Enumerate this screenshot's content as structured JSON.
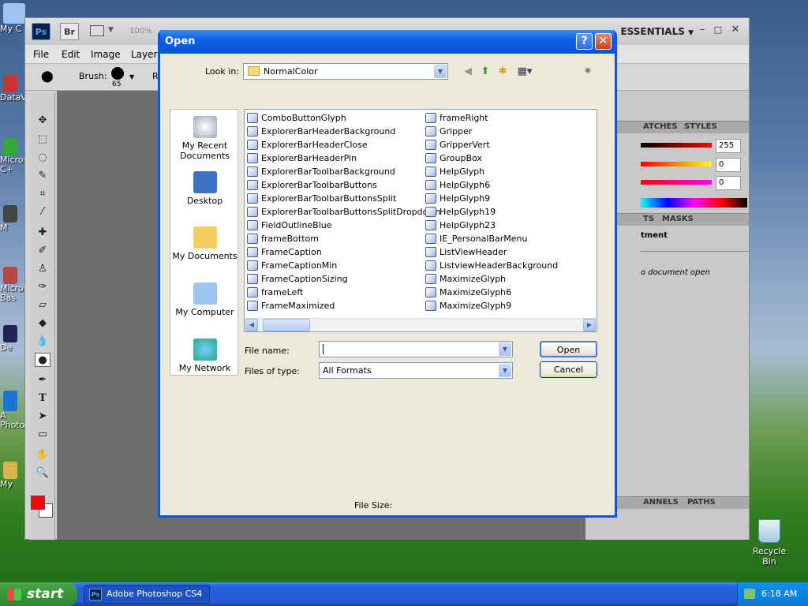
{
  "desktop": {
    "icons": [
      {
        "label": "My C",
        "name": "my-computer-desktop-icon"
      },
      {
        "label": "DataV",
        "name": "datav-desktop-icon"
      },
      {
        "label": "Micros C+",
        "name": "microsoft-cpp-desktop-icon"
      },
      {
        "label": "M",
        "name": "m-desktop-icon"
      },
      {
        "label": "Micros Bas",
        "name": "microsoft-basic-desktop-icon"
      },
      {
        "label": "De",
        "name": "de-desktop-icon"
      },
      {
        "label": "A Photo",
        "name": "adobe-photoshop-desktop-icon"
      },
      {
        "label": "My",
        "name": "my-desktop-icon"
      }
    ],
    "recycle_bin": "Recycle Bin"
  },
  "photoshop": {
    "logo": "Ps",
    "bridge": "Br",
    "zoom": "100%",
    "workspace": "ESSENTIALS",
    "menus": [
      "File",
      "Edit",
      "Image",
      "Layer"
    ],
    "options": {
      "brush_label": "Brush:",
      "brush_size": "65",
      "r_label": "R"
    },
    "panels": {
      "tabs1": [
        "ATCHES",
        "STYLES"
      ],
      "color_values": [
        "255",
        "0",
        "0"
      ],
      "tabs2": [
        "TS",
        "MASKS"
      ],
      "adjust_title": "tment",
      "no_doc": "o document open",
      "tabs3": [
        "ANNELS",
        "PATHS"
      ]
    },
    "colors": {
      "foreground": "#ff0000",
      "background": "#ffffff"
    }
  },
  "dialog": {
    "title": "Open",
    "look_in_label": "Look in:",
    "look_in_value": "NormalColor",
    "places": [
      "My Recent Documents",
      "Desktop",
      "My Documents",
      "My Computer",
      "My Network"
    ],
    "files_col1": [
      "ComboButtonGlyph",
      "ExplorerBarHeaderBackground",
      "ExplorerBarHeaderClose",
      "ExplorerBarHeaderPin",
      "ExplorerBarToolbarBackground",
      "ExplorerBarToolbarButtons",
      "ExplorerBarToolbarButtonsSplit",
      "ExplorerBarToolbarButtonsSplitDropdown",
      "FieldOutlineBlue",
      "frameBottom",
      "FrameCaption",
      "FrameCaptionMin",
      "FrameCaptionSizing",
      "frameLeft",
      "FrameMaximized"
    ],
    "files_col2": [
      "frameRight",
      "Gripper",
      "GripperVert",
      "GroupBox",
      "HelpGlyph",
      "HelpGlyph6",
      "HelpGlyph9",
      "HelpGlyph19",
      "HelpGlyph23",
      "IE_PersonalBarMenu",
      "ListViewHeader",
      "ListviewHeaderBackground",
      "MaximizeGlyph",
      "MaximizeGlyph6",
      "MaximizeGlyph9"
    ],
    "file_name_label": "File name:",
    "file_name_value": "",
    "files_of_type_label": "Files of type:",
    "files_of_type_value": "All Formats",
    "open_button": "Open",
    "cancel_button": "Cancel",
    "file_size_label": "File Size:"
  },
  "taskbar": {
    "start": "start",
    "task": "Adobe Photoshop CS4",
    "task_icon": "Ps",
    "clock": "6:18 AM"
  }
}
